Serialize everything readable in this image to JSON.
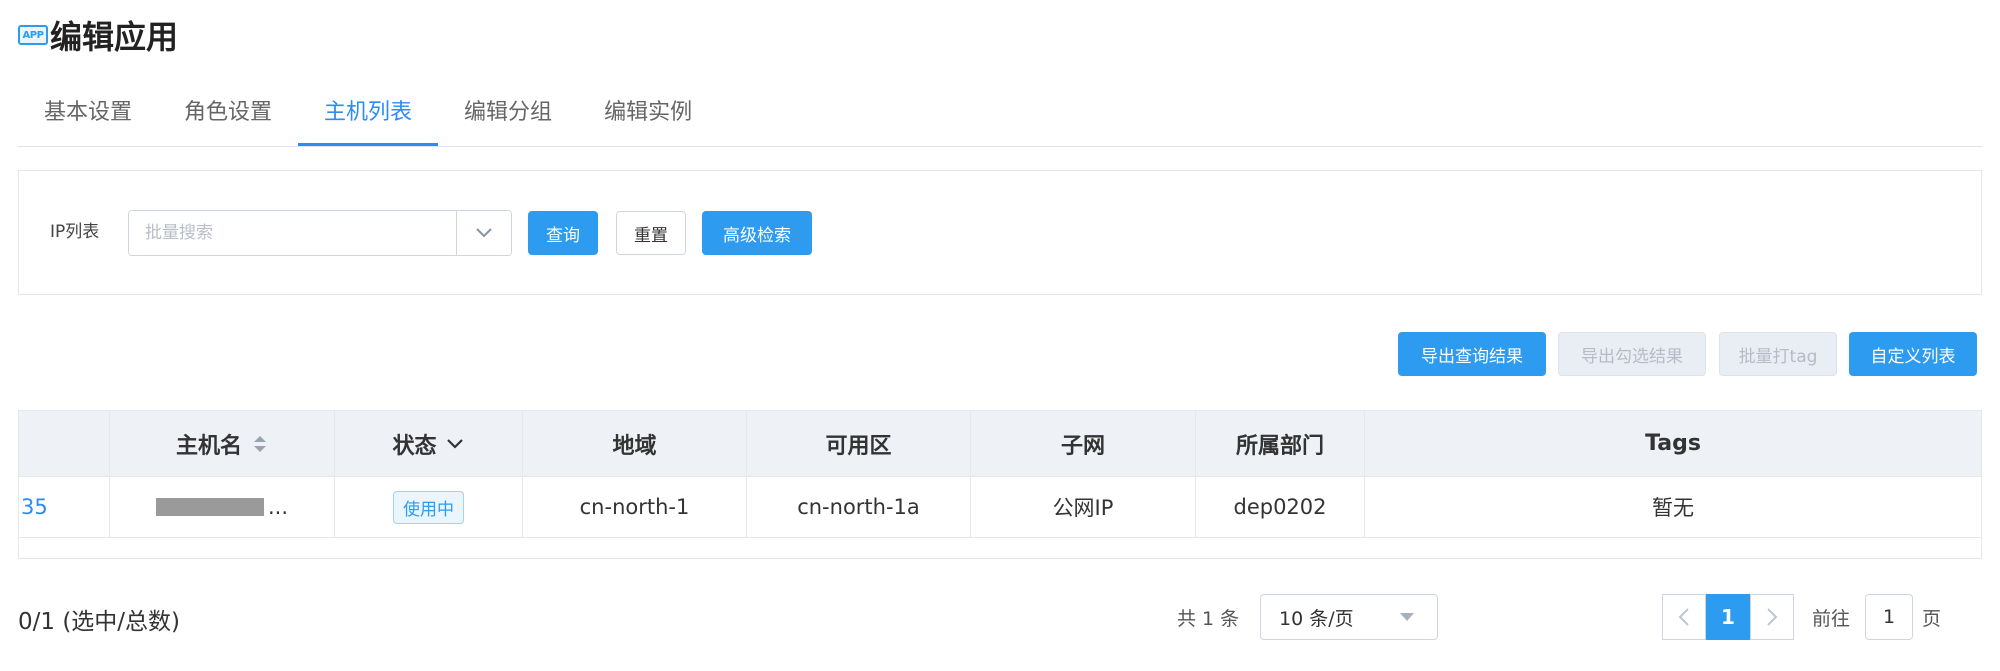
{
  "header": {
    "badge": "APP",
    "title": "编辑应用"
  },
  "tabs": [
    {
      "label": "基本设置"
    },
    {
      "label": "角色设置"
    },
    {
      "label": "主机列表",
      "active": true
    },
    {
      "label": "编辑分组"
    },
    {
      "label": "编辑实例"
    }
  ],
  "filter": {
    "ip_label": "IP列表",
    "search_placeholder": "批量搜索",
    "query_button": "查询",
    "reset_button": "重置",
    "advanced_button": "高级检索"
  },
  "toolbar": {
    "export_query": "导出查询结果",
    "export_selected": "导出勾选结果",
    "batch_tag": "批量打tag",
    "custom_columns": "自定义列表"
  },
  "table": {
    "headers": {
      "hostname": "主机名",
      "status": "状态",
      "region": "地域",
      "zone": "可用区",
      "subnet": "子网",
      "department": "所属部门",
      "tags": "Tags"
    },
    "rows": [
      {
        "first": "35",
        "hostname_suffix": "...",
        "status": "使用中",
        "region": "cn-north-1",
        "zone": "cn-north-1a",
        "subnet": "公网IP",
        "department": "dep0202",
        "tags": "暂无"
      }
    ]
  },
  "footer": {
    "selected": "0/1 (选中/总数)",
    "total": "共 1 条",
    "page_size": "10 条/页",
    "current_page": "1",
    "goto_label": "前往",
    "goto_value": "1",
    "page_unit": "页"
  },
  "colors": {
    "primary": "#2d9bf0",
    "header_bg": "#eef2f7"
  },
  "icons": [
    "app-badge-icon",
    "chevron-down-icon",
    "sort-icon",
    "chevron-left-icon",
    "chevron-right-icon",
    "caret-down-icon"
  ]
}
